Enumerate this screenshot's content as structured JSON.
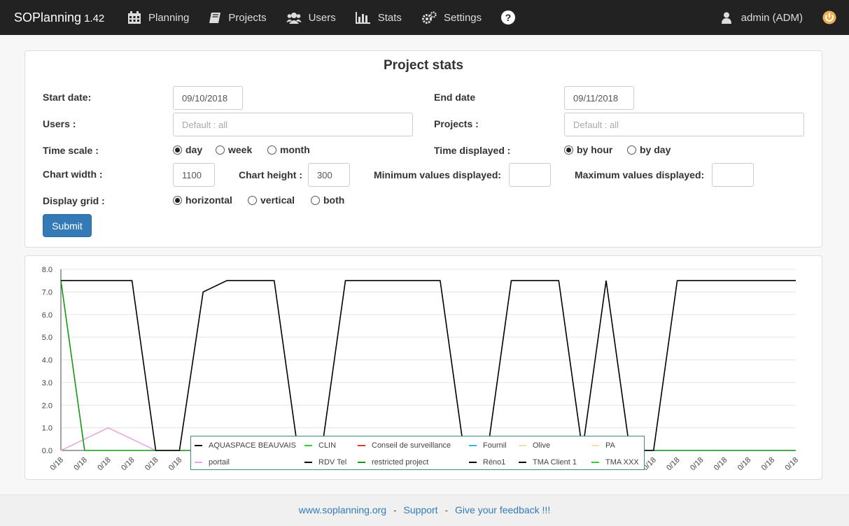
{
  "brand": {
    "name": "SOPlanning",
    "version": "1.42"
  },
  "nav": [
    {
      "label": "Planning",
      "icon": "calendar-icon"
    },
    {
      "label": "Projects",
      "icon": "book-icon"
    },
    {
      "label": "Users",
      "icon": "users-icon"
    },
    {
      "label": "Stats",
      "icon": "bar-chart-icon"
    },
    {
      "label": "Settings",
      "icon": "gears-icon"
    }
  ],
  "user": {
    "label": "admin (ADM)"
  },
  "colors": {
    "navbar": "#222222",
    "primary": "#337ab7",
    "power": "#f0ad4e",
    "legend_border": "#3a8a7a"
  },
  "form": {
    "title": "Project stats",
    "start_date_label": "Start date:",
    "start_date_value": "09/10/2018",
    "end_date_label": "End date",
    "end_date_value": "09/11/2018",
    "users_label": "Users :",
    "users_placeholder": "Default : all",
    "projects_label": "Projects :",
    "projects_placeholder": "Default : all",
    "time_scale_label": "Time scale :",
    "time_scale_options": [
      "day",
      "week",
      "month"
    ],
    "time_scale_selected": "day",
    "time_displayed_label": "Time displayed :",
    "time_displayed_options": [
      "by hour",
      "by day"
    ],
    "time_displayed_selected": "by hour",
    "chart_width_label": "Chart width :",
    "chart_width_value": "1100",
    "chart_height_label": "Chart height :",
    "chart_height_value": "300",
    "min_values_label": "Minimum values displayed:",
    "min_values_value": "",
    "max_values_label": "Maximum values displayed:",
    "max_values_value": "",
    "display_grid_label": "Display grid :",
    "display_grid_options": [
      "horizontal",
      "vertical",
      "both"
    ],
    "display_grid_selected": "horizontal",
    "submit_label": "Submit"
  },
  "chart_data": {
    "type": "line",
    "ylim": [
      0,
      8
    ],
    "y_ticks": [
      "0.0",
      "1.0",
      "2.0",
      "3.0",
      "4.0",
      "5.0",
      "6.0",
      "7.0",
      "8.0"
    ],
    "x": [
      "0/18",
      "0/18",
      "0/18",
      "0/18",
      "0/18",
      "0/18",
      "0/18",
      "0/18",
      "0/18",
      "0/18",
      "0/18",
      "0/18",
      "0/18",
      "0/18",
      "0/18",
      "0/18",
      "0/18",
      "0/18",
      "0/18",
      "0/18",
      "0/18",
      "0/18",
      "0/18",
      "0/18",
      "0/18",
      "0/18",
      "0/18",
      "0/18",
      "0/18",
      "0/18",
      "0/18",
      "0/18"
    ],
    "grid": "horizontal",
    "legend_position": "bottom",
    "series": [
      {
        "name": "AQUASPACE BEAUVAIS",
        "color": "#000000",
        "values": []
      },
      {
        "name": "CLIN",
        "color": "#33cc33",
        "values": []
      },
      {
        "name": "Conseil de surveillance",
        "color": "#e0392b",
        "values": []
      },
      {
        "name": "Fournil",
        "color": "#33b5e5",
        "values": []
      },
      {
        "name": "Olive",
        "color": "#f5deb3",
        "values": []
      },
      {
        "name": "PA",
        "color": "#f5deb3",
        "values": []
      },
      {
        "name": "portail",
        "color": "#e6a8e6",
        "values": [
          0,
          0.5,
          1,
          0.5,
          0,
          0,
          0,
          0,
          0,
          0,
          0,
          0,
          0,
          0,
          0,
          0,
          0,
          0,
          0,
          0,
          0,
          0,
          0,
          0,
          0,
          0,
          0,
          0,
          0,
          0,
          0,
          0
        ]
      },
      {
        "name": "RDV Tel",
        "color": "#000000",
        "values": []
      },
      {
        "name": "restricted project",
        "color": "#119911",
        "values": [
          7.5,
          0,
          0,
          0,
          0,
          0,
          0,
          0,
          0,
          0,
          0,
          0,
          0,
          0,
          0,
          0,
          0,
          0,
          0,
          0,
          0,
          0,
          0,
          0,
          0,
          0,
          0,
          0,
          0,
          0,
          0,
          0
        ]
      },
      {
        "name": "Réno1",
        "color": "#000000",
        "values": []
      },
      {
        "name": "TMA Client 1",
        "color": "#000000",
        "values": [
          7.5,
          7.5,
          7.5,
          7.5,
          0,
          0,
          7,
          7.5,
          7.5,
          7.5,
          0,
          0,
          7.5,
          7.5,
          7.5,
          7.5,
          7.5,
          0,
          0,
          7.5,
          7.5,
          7.5,
          0,
          7.5,
          0,
          0,
          7.5,
          7.5,
          7.5,
          7.5,
          7.5,
          7.5
        ]
      },
      {
        "name": "TMA XXX",
        "color": "#33cc33",
        "values": []
      }
    ]
  },
  "footer": {
    "link1": "www.soplanning.org",
    "sep": "-",
    "link2": "Support",
    "link3": "Give your feedback !!!"
  }
}
